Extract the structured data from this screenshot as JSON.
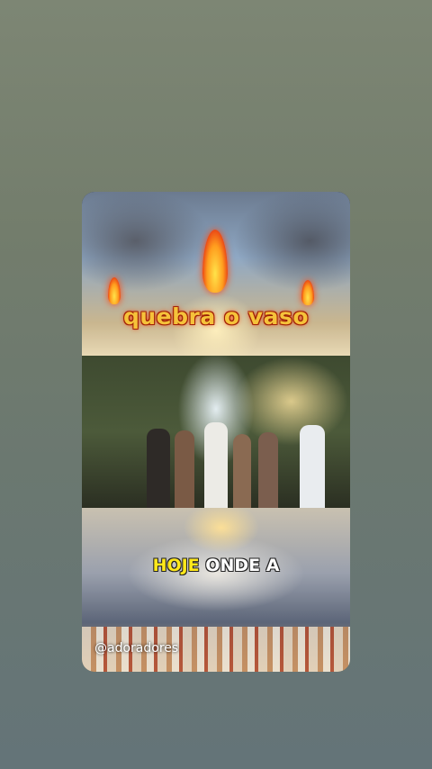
{
  "video": {
    "caption_top": "quebra o vaso",
    "caption_bottom_highlight": "HOJE",
    "caption_bottom_rest": " ONDE A",
    "watermark": "@adoradores"
  },
  "colors": {
    "caption_top_fill": "#f6c23a",
    "caption_top_outline": "#b3260a",
    "caption_highlight": "#ffe81a",
    "caption_text": "#ffffff"
  }
}
